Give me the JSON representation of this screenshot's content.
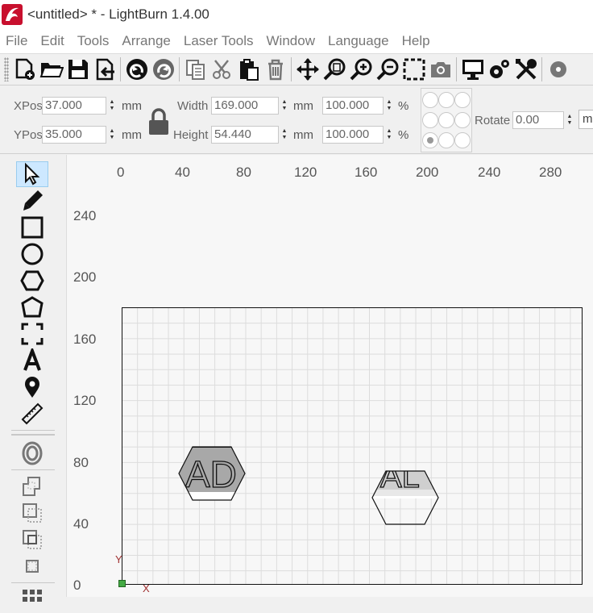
{
  "window": {
    "title": "<untitled> * - LightBurn 1.4.00"
  },
  "menu": [
    "File",
    "Edit",
    "Tools",
    "Arrange",
    "Laser Tools",
    "Window",
    "Language",
    "Help"
  ],
  "toolbar": {
    "buttons": [
      "new-file-icon",
      "open-folder-icon",
      "save-icon",
      "import-icon",
      "undo-icon",
      "redo-icon",
      "copy-icon",
      "cut-icon",
      "paste-icon",
      "delete-icon",
      "move-icon",
      "zoom-selection-icon",
      "zoom-in-icon",
      "zoom-out-icon",
      "frame-icon",
      "camera-icon",
      "monitor-icon",
      "settings-icon",
      "tools-icon"
    ]
  },
  "props": {
    "xpos_label": "XPos",
    "xpos_value": "37.000",
    "ypos_label": "YPos",
    "ypos_value": "35.000",
    "unit_mm": "mm",
    "width_label": "Width",
    "width_value": "169.000",
    "height_label": "Height",
    "height_value": "54.440",
    "scale_w": "100.000",
    "scale_h": "100.000",
    "percent": "%",
    "rotate_label": "Rotate",
    "rotate_value": "0.00",
    "rotate_unit": "m"
  },
  "palette": {
    "tools": [
      "select-icon",
      "pencil-icon",
      "rectangle-icon",
      "ellipse-icon",
      "polygon-icon",
      "edit-nodes-icon",
      "position-icon",
      "text-icon",
      "location-pin-icon",
      "ruler-icon"
    ],
    "ops": [
      "offset-icon",
      "boolean-union-icon",
      "boolean-subtract-icon",
      "boolean-intersect-icon",
      "weld-icon",
      "grid-array-icon"
    ]
  },
  "canvas": {
    "x_ticks": [
      "0",
      "40",
      "80",
      "120",
      "160",
      "200",
      "240",
      "280"
    ],
    "y_ticks": [
      "240",
      "200",
      "160",
      "120",
      "80",
      "40",
      "0"
    ],
    "origin_x_label": "X",
    "origin_y_label": "Y",
    "shape1_text": "AD",
    "shape2_text": "AL"
  },
  "colors": {
    "accent_logo": "#c8102e",
    "origin_marker": "#44aa44",
    "origin_label": "#a03030",
    "active_tool": "#cde8ff"
  }
}
